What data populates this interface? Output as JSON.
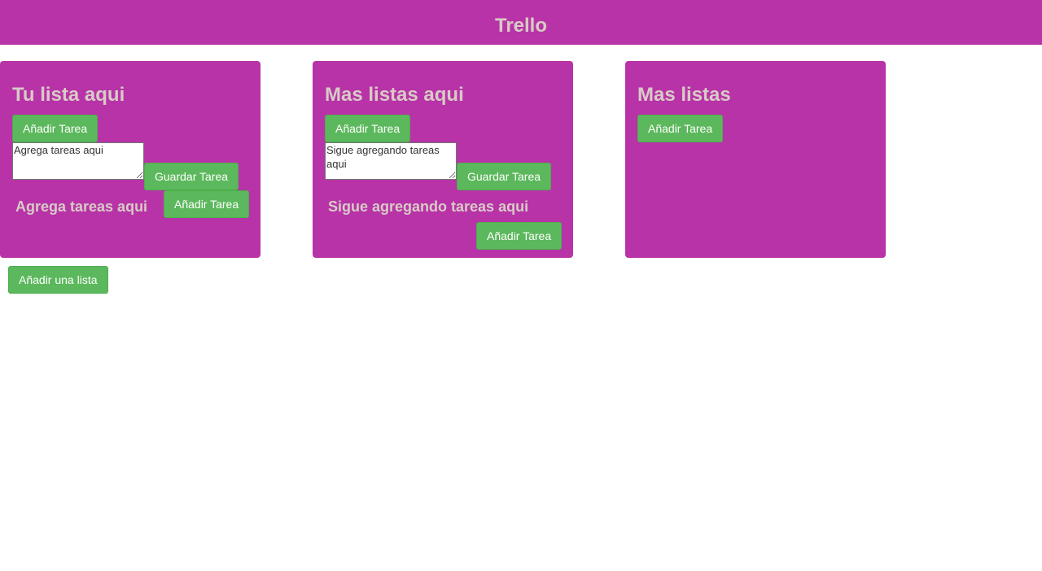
{
  "header": {
    "title": "Trello"
  },
  "lists": [
    {
      "title": "Tu lista aqui",
      "add_task_label": "Añadir Tarea",
      "input_value": "Agrega tareas aqui",
      "save_label": "Guardar Tarea",
      "task_text": "Agrega tareas aqui",
      "task_add_label": "Añadir Tarea"
    },
    {
      "title": "Mas listas aqui",
      "add_task_label": "Añadir Tarea",
      "input_value": "Sigue agregando tareas aqui",
      "save_label": "Guardar Tarea",
      "task_text": "Sigue agregando tareas aqui",
      "task_add_label": "Añadir Tarea"
    },
    {
      "title": "Mas listas",
      "add_task_label": "Añadir Tarea"
    }
  ],
  "footer": {
    "add_list_label": "Añadir una lista"
  },
  "colors": {
    "brand": "#b833a7",
    "title_text": "#d8cbc6",
    "button": "#5cb85c"
  }
}
